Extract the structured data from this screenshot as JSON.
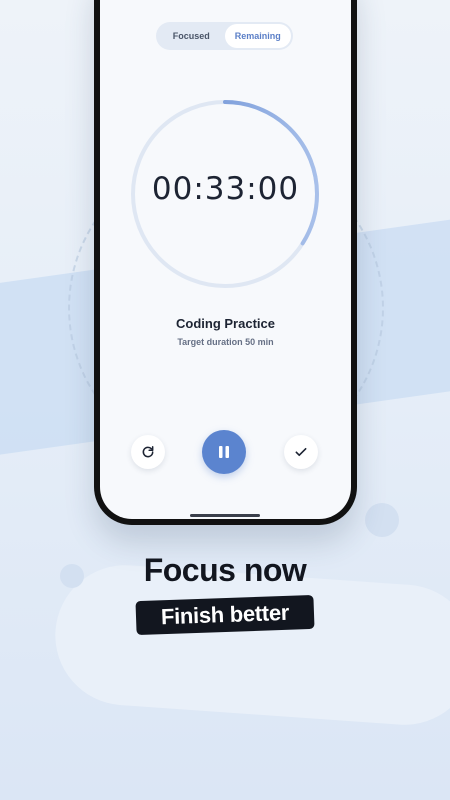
{
  "tabs": [
    {
      "label": "Focused",
      "active": false
    },
    {
      "label": "Remaining",
      "active": true
    }
  ],
  "timer": {
    "time": "00:33:00",
    "progress": 0.34,
    "accent_color": "#5b84cf"
  },
  "task": {
    "title": "Coding Practice",
    "subtitle": "Target duration 50 min"
  },
  "controls": {
    "reset_icon": "refresh-icon",
    "pause_icon": "pause-icon",
    "done_icon": "check-icon"
  },
  "promo": {
    "headline": "Focus now",
    "tagline": "Finish better"
  }
}
